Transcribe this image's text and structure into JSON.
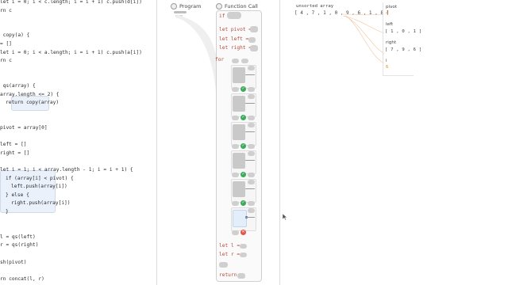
{
  "code": {
    "lines": [
      {
        "t": "let i = 0; i < c.length; i = i + 1) c.push(d[i])",
        "i": 0
      },
      {
        "t": "rn c",
        "i": 0
      },
      {
        "t": "",
        "i": 0
      },
      {
        "t": "",
        "i": 0
      },
      {
        "t": " copy(a) {",
        "i": 0
      },
      {
        "t": "= []",
        "i": 0
      },
      {
        "t": "let i = 0; i < a.length; i = i + 1) c.push(a[i])",
        "i": 0
      },
      {
        "t": "rn c",
        "i": 0
      },
      {
        "t": "",
        "i": 0
      },
      {
        "t": "",
        "i": 0
      },
      {
        "t": " qs(array) {",
        "i": 0
      },
      {
        "t": "array.length <= 2) {",
        "i": 0
      },
      {
        "t": "return copy(array)",
        "i": 1
      },
      {
        "t": "",
        "i": 0
      },
      {
        "t": "",
        "i": 0
      },
      {
        "t": "pivot = array[0]",
        "i": 0
      },
      {
        "t": "",
        "i": 0
      },
      {
        "t": "left = []",
        "i": 0
      },
      {
        "t": "right = []",
        "i": 0
      },
      {
        "t": "",
        "i": 0
      },
      {
        "t": "let i = 1; i < array.length - 1; i = i + 1) {",
        "i": 0
      },
      {
        "t": "if (array[i] < pivot) {",
        "i": 1
      },
      {
        "t": "left.push(array[i])",
        "i": 2
      },
      {
        "t": "} else {",
        "i": 1
      },
      {
        "t": "right.push(array[i])",
        "i": 2
      },
      {
        "t": "}",
        "i": 1
      },
      {
        "t": "",
        "i": 0
      },
      {
        "t": "",
        "i": 0
      },
      {
        "t": "l = qs(left)",
        "i": 0
      },
      {
        "t": "r = qs(right)",
        "i": 0
      },
      {
        "t": "",
        "i": 0
      },
      {
        "t": "sh(pivot)",
        "i": 0
      },
      {
        "t": "",
        "i": 0
      },
      {
        "t": "rn concat(l, r)",
        "i": 0
      }
    ]
  },
  "viz": {
    "program_label": "Program",
    "function_call_label": "Function Call",
    "stmt_if": "if",
    "stmt_pivot": "let pivot =",
    "stmt_left": "let left =",
    "stmt_right": "let right =",
    "stmt_for": "for",
    "stmt_l": "let l =",
    "stmt_r": "let r =",
    "stmt_return": "return"
  },
  "array": {
    "label": "unsorted array",
    "values": "[ 4 , 7 , 1 , 0 , 9 , 6 , 1 , 8 ]"
  },
  "vars": {
    "pivot_label": "pivot",
    "pivot_value": "4",
    "left_label": "left",
    "left_value": "[ 1 , 0 , 1 ]",
    "right_label": "right",
    "right_value": "[ 7 , 9 , 6 ]",
    "i_label": "i",
    "i_value": "6"
  },
  "colors": {
    "keyword": "#b24a3c",
    "check": "#3cab5a",
    "cross": "#e1564b",
    "highlight": "#eaf1fb",
    "orange": "#e38a2c"
  }
}
